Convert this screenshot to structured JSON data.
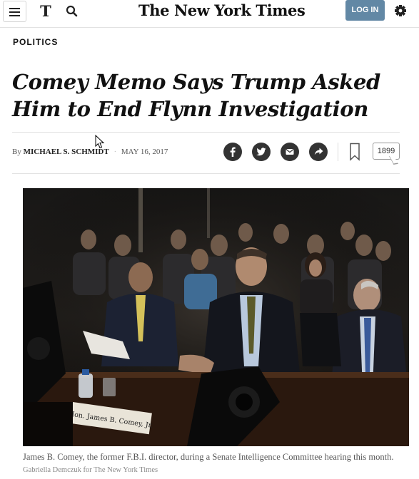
{
  "header": {
    "logo_mark": "T",
    "masthead": "The New York Times",
    "login_label": "LOG IN"
  },
  "article": {
    "section": "POLITICS",
    "headline": "Comey Memo Says Trump Asked Him to End Flynn Investigation",
    "byline_prefix": "By",
    "author": "MICHAEL S. SCHMIDT",
    "date": "MAY 16, 2017",
    "comment_count": "1899",
    "share": [
      "facebook-icon",
      "twitter-icon",
      "email-icon",
      "share-icon"
    ],
    "photo": {
      "nameplate": "Hon. James B. Comey, Jr."
    },
    "caption": "James B. Comey, the former F.B.I. director, during a Senate Intelligence Committee hearing this month.",
    "credit": "Gabriella Demczuk for The New York Times"
  },
  "colors": {
    "login": "#6288a5",
    "share_circle": "#333333"
  }
}
